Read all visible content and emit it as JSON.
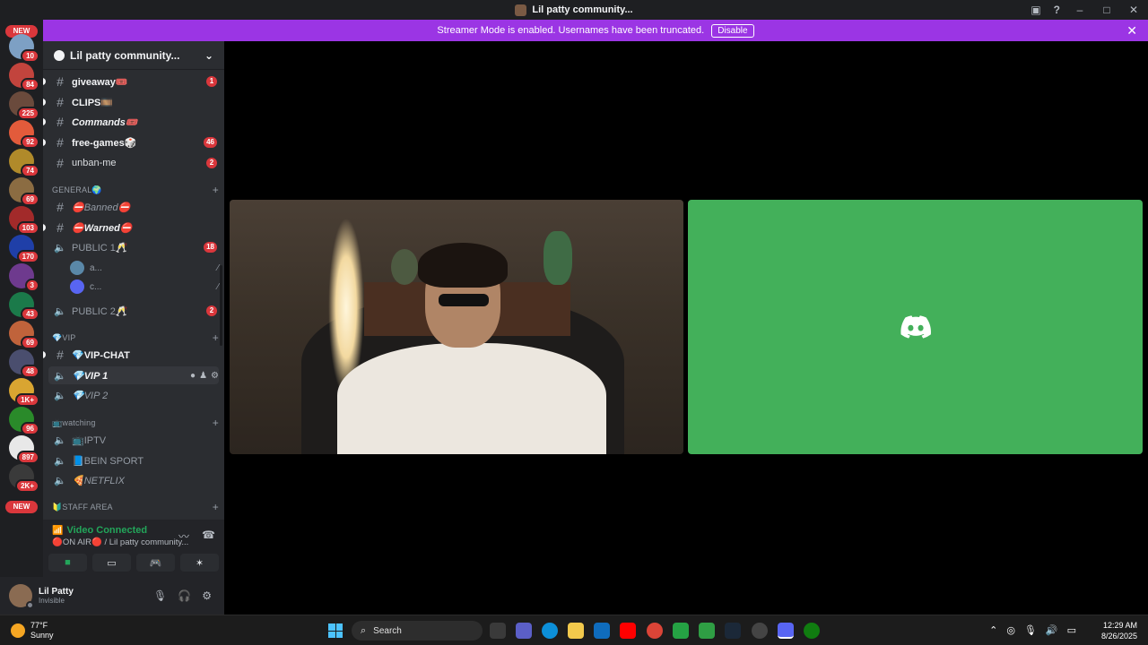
{
  "window": {
    "title": "Lil patty community..."
  },
  "banner": {
    "text": "Streamer Mode is enabled. Usernames have been truncated.",
    "disable_label": "Disable"
  },
  "servers": [
    {
      "badge": "10",
      "color": "#7da0c4"
    },
    {
      "badge": "84",
      "color": "#c2443d"
    },
    {
      "badge": "225",
      "color": "#6a4a3c"
    },
    {
      "badge": "92",
      "color": "#e25b3b"
    },
    {
      "badge": "74",
      "color": "#b08a2a"
    },
    {
      "badge": "69",
      "color": "#8b6c42"
    },
    {
      "badge": "103",
      "color": "#a22a2a"
    },
    {
      "badge": "170",
      "color": "#1f3fa8"
    },
    {
      "badge": "3",
      "color": "#6e3a8e"
    },
    {
      "badge": "43",
      "color": "#1b7a4a"
    },
    {
      "badge": "69",
      "color": "#c0633b"
    },
    {
      "badge": "48",
      "color": "#4a4e6e"
    },
    {
      "badge": "1K+",
      "color": "#d9a531"
    },
    {
      "badge": "96",
      "color": "#2a8a2a"
    },
    {
      "badge": "897",
      "color": "#e8e8e8"
    },
    {
      "badge": "2K+",
      "color": "#3a3a3a"
    }
  ],
  "new_label": "NEW",
  "guild": {
    "name": "Lil patty community..."
  },
  "channels": {
    "top": [
      {
        "name": "giveaway🎟️",
        "badge": "1",
        "type": "text"
      },
      {
        "name": "CLIPS🎞️",
        "badge": "",
        "type": "text"
      },
      {
        "name": "Commands🎟️",
        "badge": "",
        "type": "text",
        "italic": true
      },
      {
        "name": "free-games🎲",
        "badge": "46",
        "type": "text"
      },
      {
        "name": "unban-me",
        "badge": "2",
        "type": "text",
        "plain": true
      }
    ],
    "general_category": "GENERAL🌍",
    "general": [
      {
        "name": "⛔Banned⛔",
        "badge": "",
        "type": "text"
      },
      {
        "name": "⛔Warned⛔",
        "badge": "",
        "type": "text"
      },
      {
        "name": "PUBLIC 1🥂",
        "badge": "18",
        "type": "voice"
      }
    ],
    "voice_users": [
      {
        "name": "a..."
      },
      {
        "name": "c..."
      }
    ],
    "public2": {
      "name": "PUBLIC 2🥂",
      "badge": "2"
    },
    "vip_category": "💎VIP",
    "vip": [
      {
        "name": "💎VIP-CHAT",
        "type": "text"
      },
      {
        "name": "💎VIP 1",
        "type": "voice"
      },
      {
        "name": "💎VIP 2",
        "type": "voice"
      }
    ],
    "watching_category": "📺watching",
    "watching": [
      {
        "name": "📺IPTV"
      },
      {
        "name": "📘BEIN SPORT"
      },
      {
        "name": "🍕NETFLIX"
      }
    ],
    "staff_category": "🔰STAFF AREA"
  },
  "voice": {
    "status": "Video Connected",
    "subtitle": "🔴ON AIR🔴 / Lil patty community..."
  },
  "user": {
    "name": "Lil Patty",
    "status": "Invisible"
  },
  "taskbar": {
    "weather_temp": "77°F",
    "weather_desc": "Sunny",
    "search_placeholder": "Search",
    "time": "12:29 AM",
    "date": "8/26/2025"
  }
}
